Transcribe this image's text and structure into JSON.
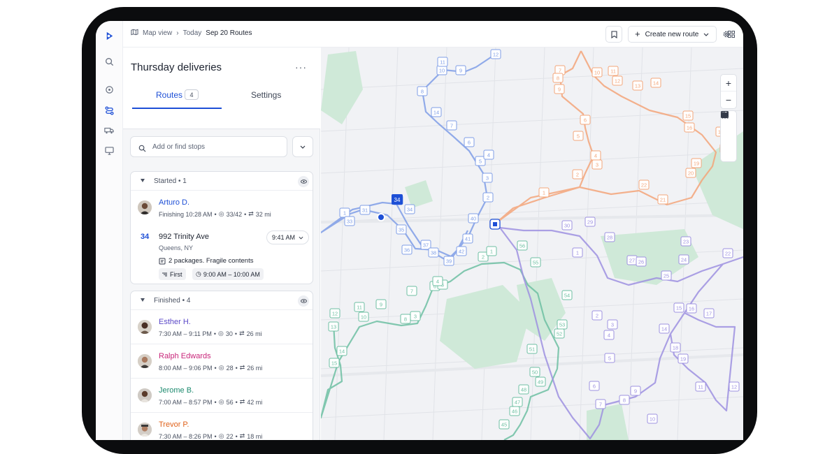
{
  "breadcrumb": {
    "view": "Map view",
    "day": "Today",
    "current": "Sep 20 Routes"
  },
  "toolbar": {
    "create_label": "Create new route"
  },
  "panel": {
    "title": "Thursday deliveries",
    "more": "···",
    "tabs": [
      {
        "label": "Routes",
        "count": "4"
      },
      {
        "label": "Settings"
      }
    ],
    "search_placeholder": "Add or find stops"
  },
  "started": {
    "label": "Started • 1",
    "driver": {
      "name": "Arturo D.",
      "status": "Finishing 10:28 AM",
      "stops": "33/42",
      "distance": "32 mi",
      "color": "#1d4fd6"
    },
    "next_stop": {
      "number": "34",
      "address": "992 Trinity Ave",
      "city": "Queens, NY",
      "time": "9:41 AM",
      "note": "2 packages. Fragile contents",
      "priority": "First",
      "window": "9:00 AM – 10:00 AM"
    }
  },
  "finished": {
    "label": "Finished • 4",
    "drivers": [
      {
        "name": "Esther H.",
        "time": "7:30 AM – 9:11 PM",
        "stops": "30",
        "distance": "26 mi",
        "color": "#5b49c8"
      },
      {
        "name": "Ralph Edwards",
        "time": "8:00 AM – 9:06 PM",
        "stops": "28",
        "distance": "26 mi",
        "color": "#c8267a"
      },
      {
        "name": "Jerome B.",
        "time": "7:00 AM – 8:57 PM",
        "stops": "56",
        "distance": "42 mi",
        "color": "#1d8a6e"
      },
      {
        "name": "Trevor P.",
        "time": "7:30 AM – 8:26 PM",
        "stops": "22",
        "distance": "18 mi",
        "color": "#e0621b"
      }
    ]
  },
  "map": {
    "labels": {
      "blue": [
        "12",
        "9",
        "10",
        "11",
        "8",
        "14",
        "7",
        "6",
        "5",
        "4",
        "3",
        "2",
        "1",
        "31",
        "33",
        "32",
        "34",
        "35",
        "36",
        "37",
        "38",
        "39",
        "40",
        "41",
        "42"
      ],
      "orange": [
        "7",
        "8",
        "9",
        "10",
        "11",
        "12",
        "13",
        "14",
        "6",
        "15",
        "16",
        "5",
        "17",
        "18",
        "4",
        "3",
        "19",
        "20",
        "2",
        "22",
        "1",
        "21"
      ],
      "green": [
        "12",
        "11",
        "9",
        "10",
        "13",
        "8",
        "3",
        "14",
        "15",
        "7",
        "6",
        "5",
        "4",
        "2",
        "1",
        "56",
        "55",
        "54",
        "53",
        "52",
        "51",
        "50",
        "49",
        "48",
        "47",
        "46",
        "45"
      ],
      "purple": [
        "30",
        "29",
        "28",
        "1",
        "27",
        "26",
        "23",
        "24",
        "25",
        "22",
        "16",
        "15",
        "17",
        "14",
        "18",
        "19",
        "2",
        "3",
        "4",
        "5",
        "6",
        "7",
        "8",
        "9",
        "10",
        "11",
        "12"
      ]
    },
    "colors": {
      "blue": "#7f9ee6",
      "orange": "#f3a579",
      "green": "#6dbfa2",
      "purple": "#9d91e0"
    }
  }
}
